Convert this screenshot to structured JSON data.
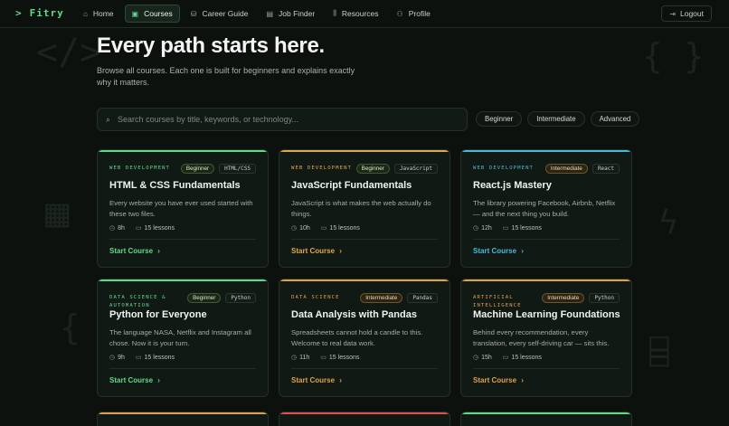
{
  "brand": {
    "prompt": ">",
    "name": "Fitry"
  },
  "nav": {
    "items": [
      {
        "label": "Home",
        "icon": "home-icon",
        "active": false
      },
      {
        "label": "Courses",
        "icon": "book-icon",
        "active": true
      },
      {
        "label": "Career Guide",
        "icon": "briefcase-icon",
        "active": false
      },
      {
        "label": "Job Finder",
        "icon": "job-icon",
        "active": false
      },
      {
        "label": "Resources",
        "icon": "library-icon",
        "active": false
      },
      {
        "label": "Profile",
        "icon": "user-icon",
        "active": false
      }
    ],
    "logout": "Logout"
  },
  "hero": {
    "title": "Every path starts here.",
    "subtitle": "Browse all courses. Each one is built for beginners and explains exactly why it matters."
  },
  "search": {
    "placeholder": "Search courses by title, keywords, or technology..."
  },
  "filters": [
    "Beginner",
    "Intermediate",
    "Advanced"
  ],
  "colors": {
    "web": "#e0a84b",
    "webLightBlue": "#4bb8d9",
    "green": "#5fd98a",
    "orange": "#e0a04b"
  },
  "cards": [
    {
      "category": "WEB DEVELOPMENT",
      "level": "Beginner",
      "tech": "HTML/CSS",
      "title": "HTML & CSS Fundamentals",
      "desc": "Every website you have ever used started with these two files.",
      "hours": "8h",
      "lessons": "15 lessons",
      "cta": "Start Course",
      "accent": "#5fd98a"
    },
    {
      "category": "WEB DEVELOPMENT",
      "level": "Beginner",
      "tech": "JavaScript",
      "title": "JavaScript Fundamentals",
      "desc": "JavaScript is what makes the web actually do things.",
      "hours": "10h",
      "lessons": "15 lessons",
      "cta": "Start Course",
      "accent": "#e0a84b"
    },
    {
      "category": "WEB DEVELOPMENT",
      "level": "Intermediate",
      "tech": "React",
      "title": "React.js Mastery",
      "desc": "The library powering Facebook, Airbnb, Netflix — and the next thing you build.",
      "hours": "12h",
      "lessons": "15 lessons",
      "cta": "Start Course",
      "accent": "#4bb8d9"
    },
    {
      "category": "DATA SCIENCE & AUTOMATION",
      "level": "Beginner",
      "tech": "Python",
      "title": "Python for Everyone",
      "desc": "The language NASA, Netflix and Instagram all chose. Now it is your turn.",
      "hours": "9h",
      "lessons": "15 lessons",
      "cta": "Start Course",
      "accent": "#5fd98a"
    },
    {
      "category": "DATA SCIENCE",
      "level": "Intermediate",
      "tech": "Pandas",
      "title": "Data Analysis with Pandas",
      "desc": "Spreadsheets cannot hold a candle to this. Welcome to real data work.",
      "hours": "11h",
      "lessons": "15 lessons",
      "cta": "Start Course",
      "accent": "#e0a04b"
    },
    {
      "category": "ARTIFICIAL INTELLIGENCE",
      "level": "Intermediate",
      "tech": "Python",
      "title": "Machine Learning Foundations",
      "desc": "Behind every recommendation, every translation, every self-driving car — sits this.",
      "hours": "15h",
      "lessons": "15 lessons",
      "cta": "Start Course",
      "accent": "#e0a04b"
    }
  ]
}
